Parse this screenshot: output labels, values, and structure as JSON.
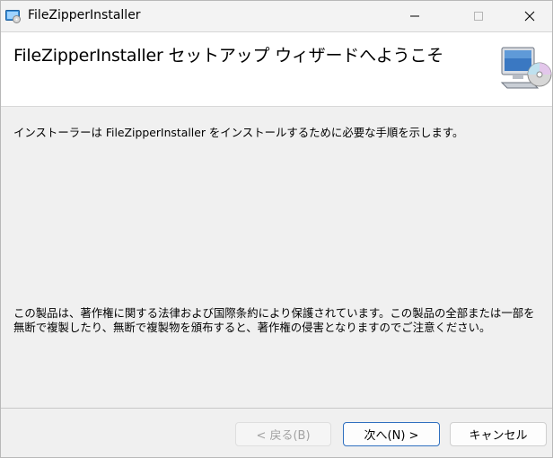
{
  "window": {
    "title": "FileZipperInstaller"
  },
  "banner": {
    "title": "FileZipperInstaller セットアップ ウィザードへようこそ"
  },
  "content": {
    "intro": "インストーラーは FileZipperInstaller をインストールするために必要な手順を示します。",
    "copyright": "この製品は、著作権に関する法律および国際条約により保護されています。この製品の全部または一部を無断で複製したり、無断で複製物を頒布すると、著作権の侵害となりますのでご注意ください。"
  },
  "buttons": {
    "back": "< 戻る(B)",
    "next": "次へ(N) >",
    "cancel": "キャンセル"
  },
  "colors": {
    "accent": "#2f6fbf",
    "banner_bg": "#ffffff",
    "dialog_bg": "#f0f0f0"
  },
  "icons": {
    "app": "installer-app-icon",
    "banner": "computer-cd-icon",
    "minimize": "minimize-icon",
    "maximize": "maximize-icon",
    "close": "close-icon"
  }
}
